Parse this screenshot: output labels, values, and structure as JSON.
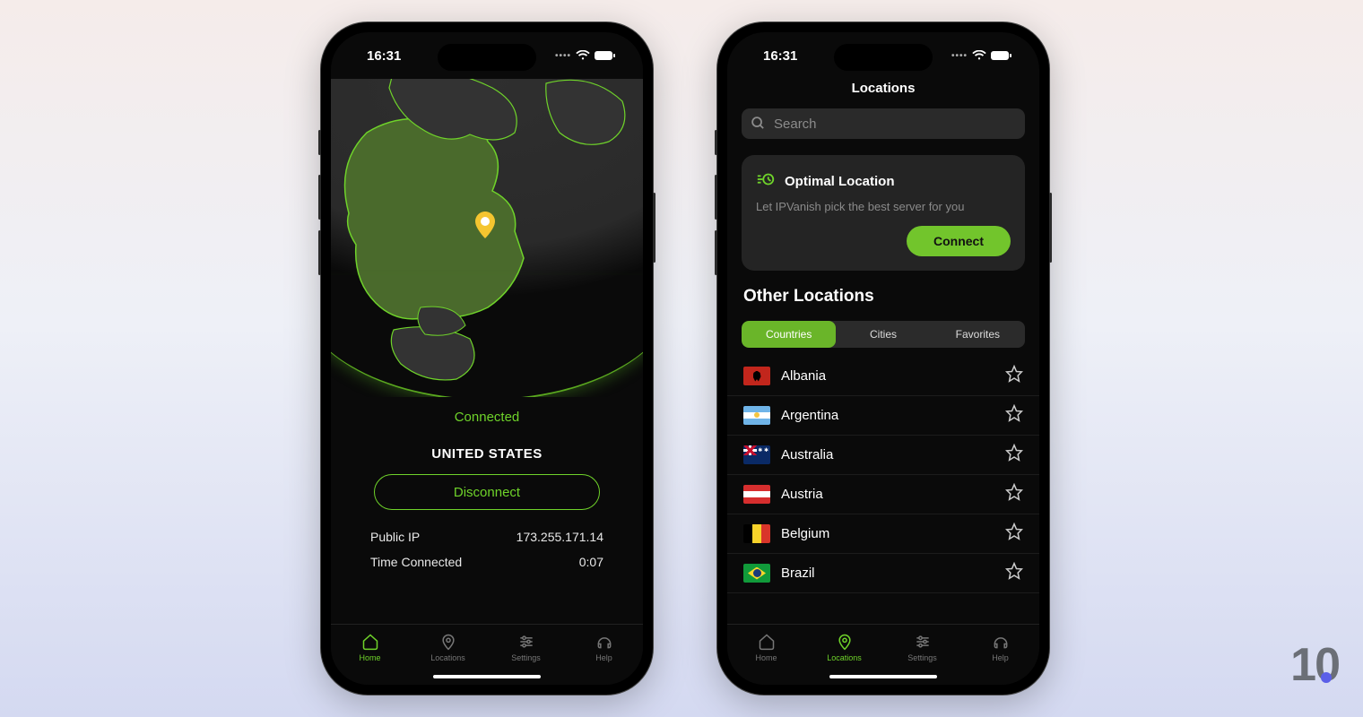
{
  "status_bar": {
    "time": "16:31"
  },
  "home": {
    "status": "Connected",
    "country": "UNITED STATES",
    "disconnect_label": "Disconnect",
    "public_ip_label": "Public IP",
    "public_ip_value": "173.255.171.14",
    "time_connected_label": "Time Connected",
    "time_connected_value": "0:07"
  },
  "locations": {
    "title": "Locations",
    "search_placeholder": "Search",
    "optimal_title": "Optimal Location",
    "optimal_subtitle": "Let IPVanish pick the best server for you",
    "connect_label": "Connect",
    "section_title": "Other Locations",
    "segments": {
      "countries": "Countries",
      "cities": "Cities",
      "favorites": "Favorites"
    },
    "countries": [
      {
        "name": "Albania",
        "flag": "al"
      },
      {
        "name": "Argentina",
        "flag": "ar"
      },
      {
        "name": "Australia",
        "flag": "au"
      },
      {
        "name": "Austria",
        "flag": "at"
      },
      {
        "name": "Belgium",
        "flag": "be"
      },
      {
        "name": "Brazil",
        "flag": "br"
      }
    ]
  },
  "tabs": {
    "home": "Home",
    "locations": "Locations",
    "settings": "Settings",
    "help": "Help"
  },
  "watermark": "10"
}
